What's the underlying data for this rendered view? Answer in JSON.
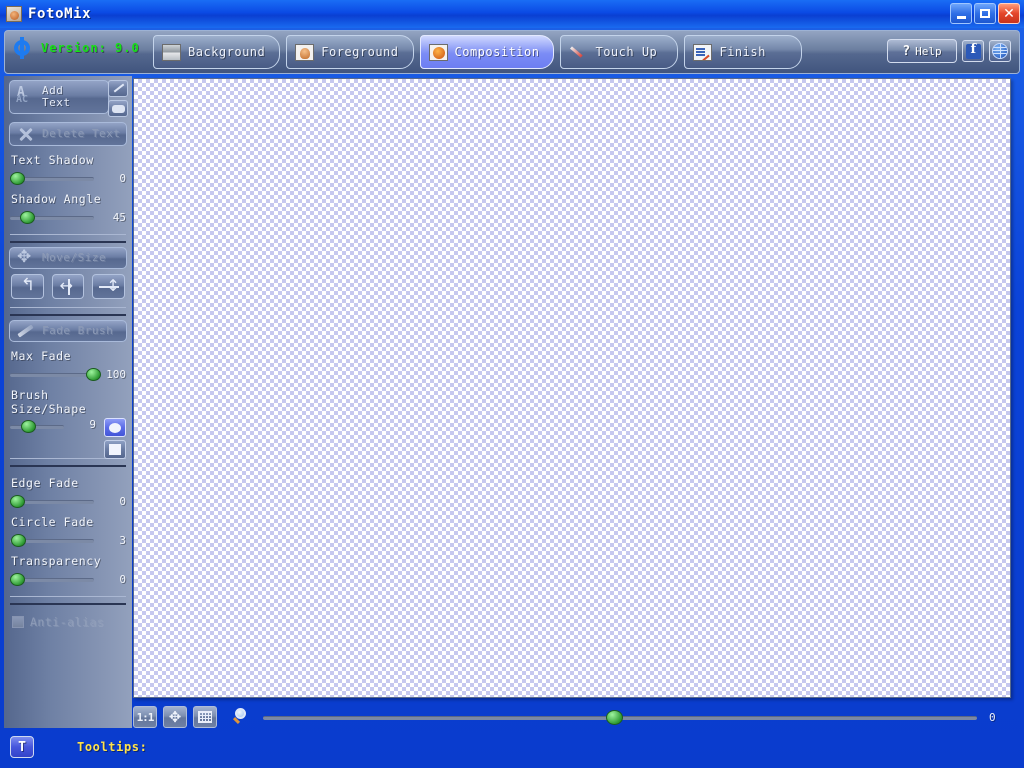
{
  "window": {
    "title": "FotoMix",
    "icon": "photo-app-icon",
    "controls": {
      "minimize": "minimize-icon",
      "maximize": "maximize-icon",
      "close": "close-icon"
    }
  },
  "brand": {
    "logo_icon": "fotomix-logo-icon",
    "version_text": "Version: 9.0",
    "version_color": "#16e116"
  },
  "tabs": [
    {
      "label": "Background",
      "icon": "background-image-icon",
      "active": false
    },
    {
      "label": "Foreground",
      "icon": "foreground-person-icon",
      "active": false
    },
    {
      "label": "Composition",
      "icon": "composition-icon",
      "active": true
    },
    {
      "label": "Touch Up",
      "icon": "brush-icon",
      "active": false
    },
    {
      "label": "Finish",
      "icon": "finish-document-icon",
      "active": false
    }
  ],
  "header_actions": {
    "help_label": "Help",
    "help_icon": "question-mark-icon",
    "facebook_icon": "facebook-icon",
    "web_icon": "globe-icon"
  },
  "sidebar": {
    "add_text": {
      "label_line1": "Add",
      "label_line2": "Text",
      "icon": "add-text-icon",
      "enabled": true,
      "mini_buttons": [
        {
          "name": "text-edit-pen-button",
          "icon": "pen-icon"
        },
        {
          "name": "text-style-button",
          "icon": "rounded-rect-icon"
        }
      ]
    },
    "delete_text": {
      "label": "Delete Text",
      "icon": "delete-x-icon",
      "enabled": false
    },
    "sliders_text": [
      {
        "label": "Text Shadow",
        "value": 0,
        "percent": 0
      },
      {
        "label": "Shadow Angle",
        "value": 45,
        "percent": 12
      }
    ],
    "move_size": {
      "label": "Move/Size",
      "icon": "move-size-icon",
      "enabled": false
    },
    "transform_buttons": [
      {
        "name": "rotate-button",
        "icon": "rotate-arrow-icon"
      },
      {
        "name": "flip-horizontal-button",
        "icon": "flip-horizontal-icon"
      },
      {
        "name": "flip-vertical-button",
        "icon": "flip-vertical-icon"
      }
    ],
    "fade_brush": {
      "label": "Fade Brush",
      "icon": "fade-brush-icon",
      "enabled": false
    },
    "max_fade": {
      "label": "Max Fade",
      "value": 100,
      "percent": 97
    },
    "brush_size": {
      "label": "Brush Size/Shape",
      "value": 9,
      "percent": 22,
      "shapes": [
        {
          "name": "brush-shape-circle-button",
          "icon": "circle-icon",
          "selected": true
        },
        {
          "name": "brush-shape-square-button",
          "icon": "square-icon",
          "selected": false
        }
      ]
    },
    "sliders_fade": [
      {
        "label": "Edge Fade",
        "value": 0,
        "percent": 0
      },
      {
        "label": "Circle Fade",
        "value": 3,
        "percent": 1
      },
      {
        "label": "Transparency",
        "value": 0,
        "percent": 0
      }
    ],
    "anti_alias": {
      "label": "Anti-alias",
      "checked": false,
      "enabled": false
    }
  },
  "canvas": {
    "name": "image-canvas",
    "pattern": "transparency-checkerboard"
  },
  "bottom_toolbar": {
    "buttons": [
      {
        "name": "zoom-actual-size-button",
        "label": "1:1",
        "icon": "one-to-one-icon"
      },
      {
        "name": "fit-to-window-button",
        "label": "",
        "icon": "fit-window-icon"
      },
      {
        "name": "toggle-grid-button",
        "label": "",
        "icon": "grid-icon"
      }
    ],
    "zoom_icon": "magnifier-icon",
    "zoom_value": 0,
    "zoom_percent": 50
  },
  "status_bar": {
    "tooltip_toggle": {
      "label": "T",
      "name": "tooltip-toggle-button"
    },
    "tooltips_label": "Tooltips:",
    "tooltips_text": "",
    "label_color": "#ffe24d"
  }
}
